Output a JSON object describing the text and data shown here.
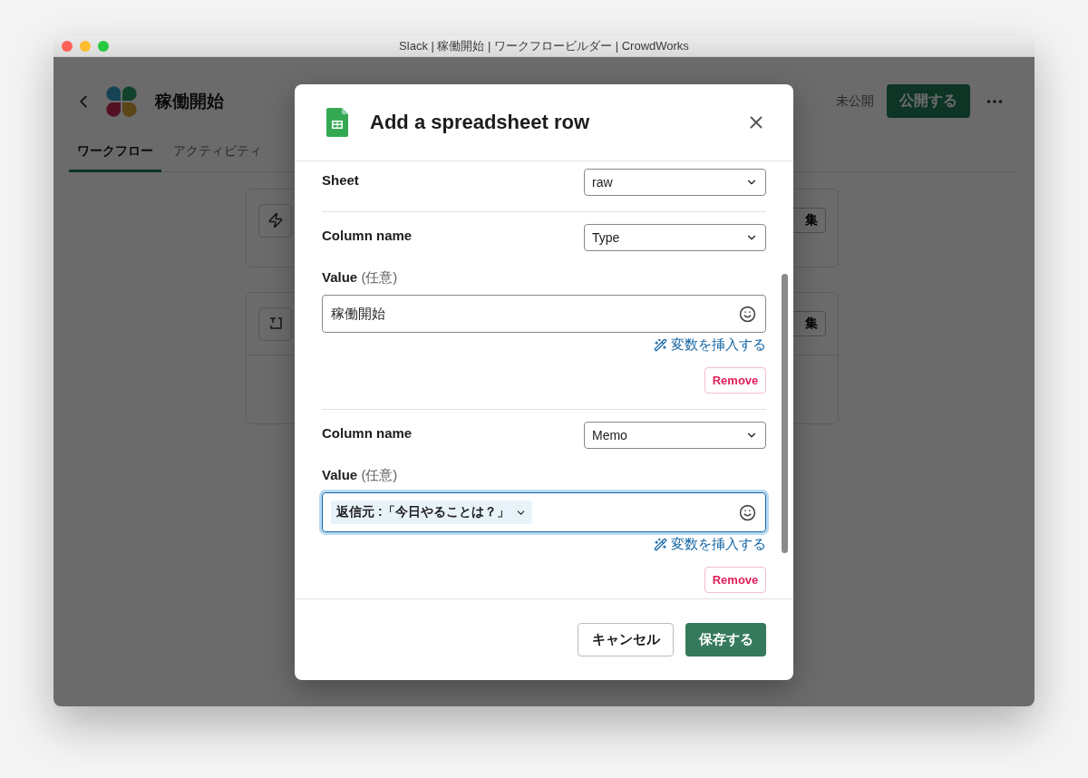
{
  "window": {
    "title": "Slack | 稼働開始 | ワークフロービルダー | CrowdWorks"
  },
  "app": {
    "workflow_name": "稼働開始",
    "status": "未公開",
    "publish_button": "公開する",
    "tabs": [
      {
        "label": "ワークフロー",
        "selected": true
      },
      {
        "label": "アクティビティ",
        "selected": false
      }
    ],
    "steps": [
      {
        "kind": "trigger",
        "button": "集"
      },
      {
        "kind": "message",
        "button": "集"
      }
    ]
  },
  "dialog": {
    "title": "Add a spreadsheet row",
    "sheet": {
      "label": "Sheet",
      "value": "raw"
    },
    "columns": [
      {
        "label": "Column name",
        "value": "Type",
        "value_label": "Value",
        "value_hint": "(任意)",
        "input": {
          "kind": "text",
          "text": "稼働開始"
        },
        "focused": false,
        "insert_variable": "変数を挿入する",
        "remove": "Remove"
      },
      {
        "label": "Column name",
        "value": "Memo",
        "value_label": "Value",
        "value_hint": "(任意)",
        "input": {
          "kind": "token",
          "text": "返信元 :「今日やることは？」"
        },
        "focused": true,
        "insert_variable": "変数を挿入する",
        "remove": "Remove"
      }
    ],
    "cancel": "キャンセル",
    "save": "保存する"
  }
}
